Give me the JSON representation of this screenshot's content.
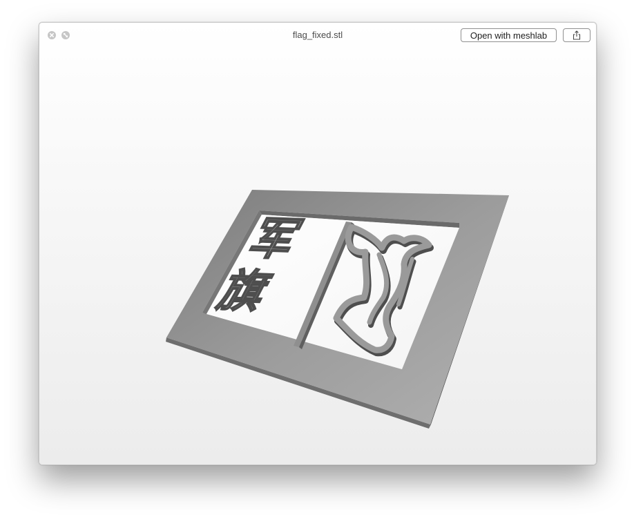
{
  "window": {
    "title": "flag_fixed.stl"
  },
  "toolbar": {
    "open_label": "Open with meshlab",
    "share_icon": "share-icon"
  },
  "traffic_lights": {
    "close_icon": "close-icon",
    "fullscreen_icon": "fullscreen-icon"
  },
  "model": {
    "characters": [
      "军",
      "旗"
    ],
    "color": "#9a9a9a"
  }
}
